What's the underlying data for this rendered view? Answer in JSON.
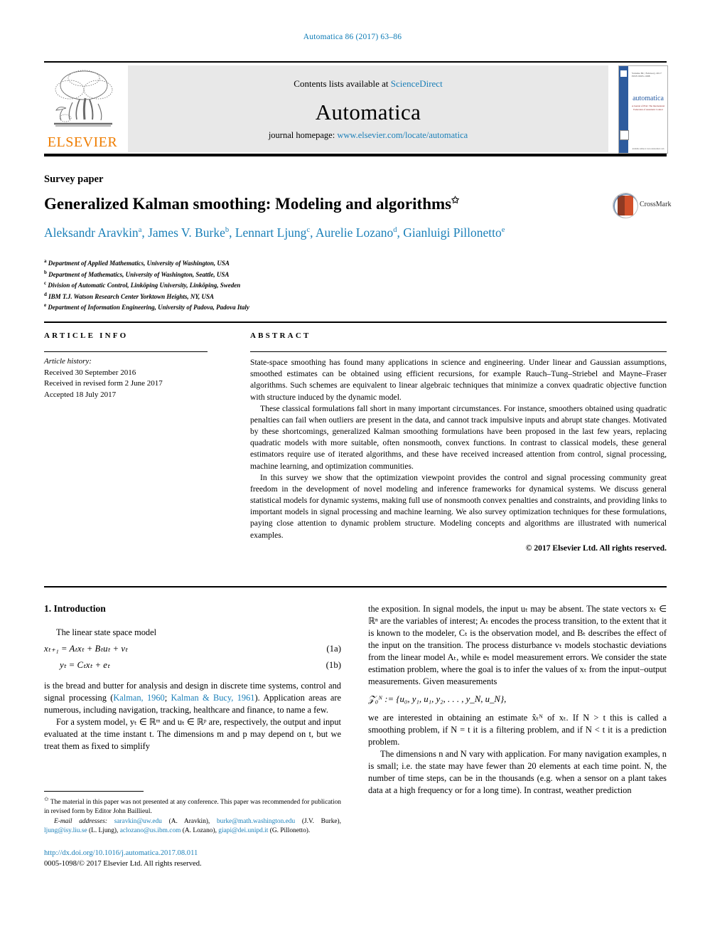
{
  "running_head": "Automatica 86 (2017) 63–86",
  "masthead": {
    "contents_prefix": "Contents lists available at ",
    "sciencedirect": "ScienceDirect",
    "journal_name": "Automatica",
    "homepage_prefix": "journal homepage: ",
    "homepage_url": "www.elsevier.com/locate/automatica",
    "publisher": "ELSEVIER",
    "cover": {
      "top_line": "Volume 86 | February 2017      ISSN 0005-1098",
      "title": "automatica",
      "subtitle": "A Journal of IFAC The International Federation of Automatic Control",
      "footer": "Available online at www.sciencedirect.com",
      "spine_color": "#2d5b9e"
    }
  },
  "article": {
    "paper_type": "Survey paper",
    "title": "Generalized Kalman smoothing: Modeling and algorithms",
    "title_footnote_marker": "✩",
    "authors": [
      {
        "name": "Aleksandr Aravkin",
        "marker": "a"
      },
      {
        "name": "James V. Burke",
        "marker": "b"
      },
      {
        "name": "Lennart Ljung",
        "marker": "c"
      },
      {
        "name": "Aurelie Lozano",
        "marker": "d"
      },
      {
        "name": "Gianluigi Pillonetto",
        "marker": "e"
      }
    ],
    "affiliations": [
      {
        "marker": "a",
        "text": "Department of Applied Mathematics, University of Washington, USA"
      },
      {
        "marker": "b",
        "text": "Department of Mathematics, University of Washington, Seattle, USA"
      },
      {
        "marker": "c",
        "text": "Division of Automatic Control, Linköping University, Linköping, Sweden"
      },
      {
        "marker": "d",
        "text": "IBM T.J. Watson Research Center Yorktown Heights, NY, USA"
      },
      {
        "marker": "e",
        "text": "Department of Information Engineering, University of Padova, Padova Italy"
      }
    ],
    "crossmark_label": "CrossMark"
  },
  "info": {
    "heading": "ARTICLE INFO",
    "history_title": "Article history:",
    "history": [
      "Received 30 September 2016",
      "Received in revised form 2 June 2017",
      "Accepted 18 July 2017"
    ]
  },
  "abstract": {
    "heading": "ABSTRACT",
    "paragraphs": [
      "State-space smoothing has found many applications in science and engineering. Under linear and Gaussian assumptions, smoothed estimates can be obtained using efficient recursions, for example Rauch–Tung–Striebel and Mayne–Fraser algorithms. Such schemes are equivalent to linear algebraic techniques that minimize a convex quadratic objective function with structure induced by the dynamic model.",
      "These classical formulations fall short in many important circumstances. For instance, smoothers obtained using quadratic penalties can fail when outliers are present in the data, and cannot track impulsive inputs and abrupt state changes. Motivated by these shortcomings, generalized Kalman smoothing formulations have been proposed in the last few years, replacing quadratic models with more suitable, often nonsmooth, convex functions. In contrast to classical models, these general estimators require use of iterated algorithms, and these have received increased attention from control, signal processing, machine learning, and optimization communities.",
      "In this survey we show that the optimization viewpoint provides the control and signal processing community great freedom in the development of novel modeling and inference frameworks for dynamical systems. We discuss general statistical models for dynamic systems, making full use of nonsmooth convex penalties and constraints, and providing links to important models in signal processing and machine learning. We also survey optimization techniques for these formulations, paying close attention to dynamic problem structure. Modeling concepts and algorithms are illustrated with numerical examples."
    ],
    "copyright": "© 2017 Elsevier Ltd. All rights reserved."
  },
  "body": {
    "section_heading": "1. Introduction",
    "left": {
      "lead": "The linear state space model",
      "equations": [
        {
          "label": "(1a)",
          "text": "xₜ₊₁ = Aₜxₜ + Bₜuₜ + vₜ"
        },
        {
          "label": "(1b)",
          "text": "yₜ = Cₜxₜ + eₜ"
        }
      ],
      "para1_pre": "is the bread and butter for analysis and design in discrete time systems, control and signal processing (",
      "cite1": "Kalman, 1960",
      "cite_sep": "; ",
      "cite2": "Kalman & Bucy, 1961",
      "para1_post": "). Application areas are numerous, including navigation, tracking,   healthcare and finance, to name a few.",
      "para2": "For a system model, yₜ ∈ ℝᵐ and uₜ ∈ ℝᵖ are, respectively, the output and input evaluated at the time instant t. The dimensions m and p may depend on t, but we treat them as fixed to simplify"
    },
    "right": {
      "para1": "the exposition. In signal models, the input uₜ may be absent. The state vectors xₜ ∈ ℝⁿ are the variables of interest; Aₜ encodes the process transition, to the extent that it is known to the modeler, Cₜ is the observation model, and Bₜ describes the effect of the input on the transition. The process disturbance vₜ models stochastic deviations from the linear model Aₜ, while eₜ model measurement errors. We consider the state estimation problem, where the goal is to infer the values of xₜ from the input–output measurements. Given measurements",
      "equation": "𝒵₀ᴺ := {u₀, y₁, u₁, y₂, . . . , y_N, u_N},",
      "para2": "we are interested in obtaining an estimate x̂ₜᴺ of xₜ. If N > t this is called a smoothing problem, if N = t it is a filtering problem, and if N < t it is a prediction problem.",
      "para3": "The dimensions n and N vary with application. For many navigation examples, n is small; i.e. the state may have fewer than 20 elements at each time point. N, the number of time steps, can be in the thousands (e.g. when a sensor on a plant takes data at a high frequency or for a long time). In contrast, weather prediction"
    }
  },
  "footnote": {
    "star": "✩",
    "note": " The material in this paper was not presented at any conference. This paper was recommended for publication in revised form by Editor John Baillieul.",
    "emails_label": "E-mail addresses:",
    "emails": [
      {
        "address": "saravkin@uw.edu",
        "owner": "(A. Aravkin)"
      },
      {
        "address": "burke@math.washington.edu",
        "owner": "(J.V. Burke)"
      },
      {
        "address": "ljung@isy.liu.se",
        "owner": "(L. Ljung)"
      },
      {
        "address": "aclozano@us.ibm.com",
        "owner": "(A. Lozano)"
      },
      {
        "address": "giapi@dei.unipd.it",
        "owner": "(G. Pillonetto)"
      }
    ]
  },
  "imprint": {
    "doi": "http://dx.doi.org/10.1016/j.automatica.2017.08.011",
    "issn_line": "0005-1098/© 2017 Elsevier Ltd. All rights reserved."
  },
  "colors": {
    "link": "#1a7fb8",
    "elsevier_orange": "#ef7d00",
    "masthead_bg": "#e8e8e8"
  }
}
